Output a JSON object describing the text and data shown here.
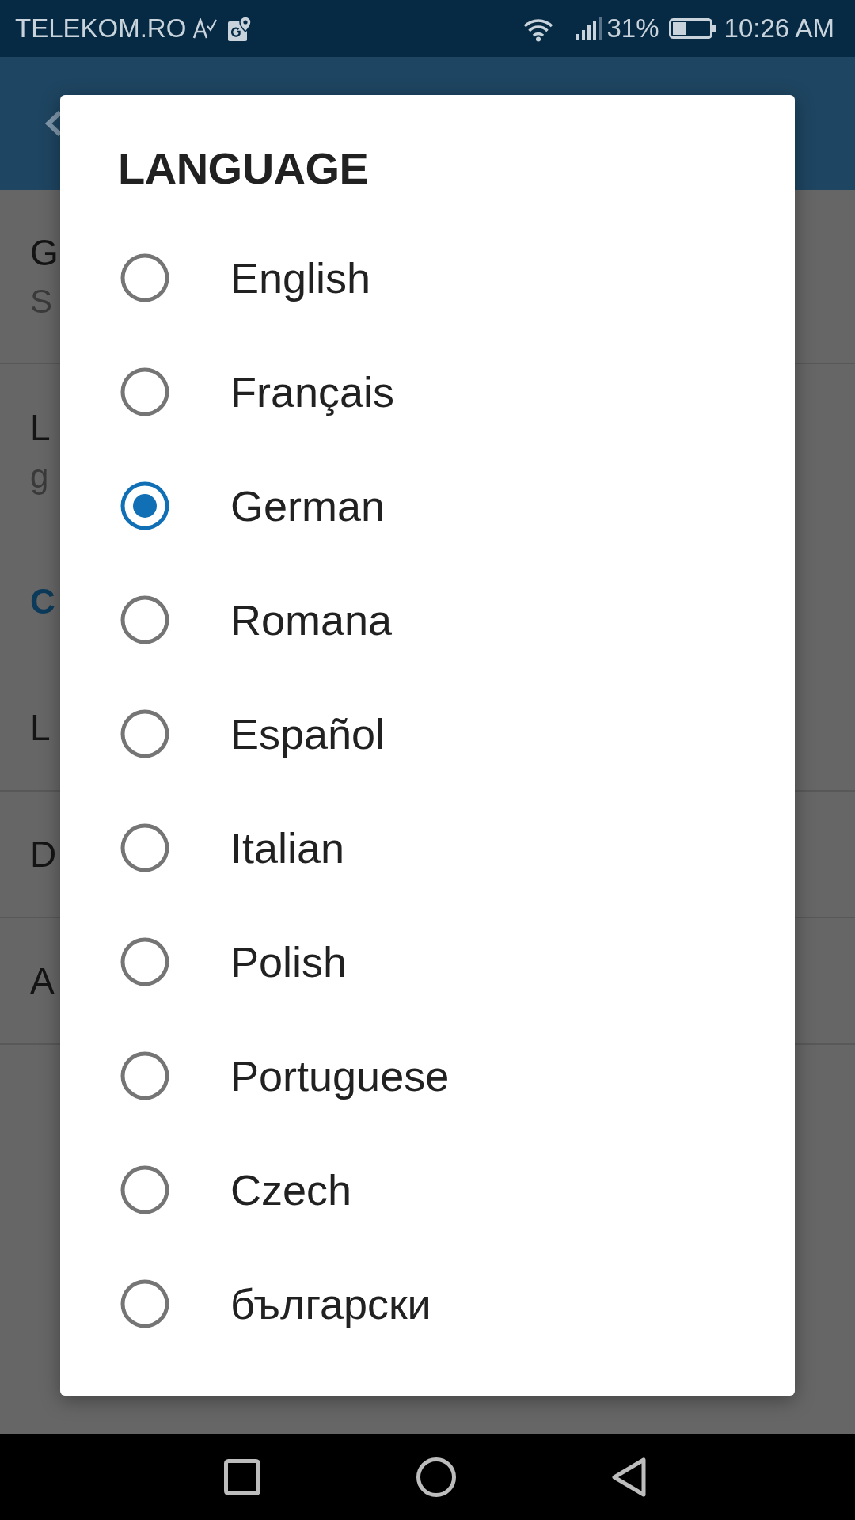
{
  "status_bar": {
    "carrier": "TELEKOM.RO",
    "battery_percent": "31%",
    "time": "10:26 AM"
  },
  "background": {
    "rows": [
      {
        "kind": "item",
        "title": "G",
        "subtitle": "S"
      },
      {
        "kind": "item",
        "title": "L",
        "subtitle": "g"
      },
      {
        "kind": "header",
        "title": "C"
      },
      {
        "kind": "item",
        "title": "L"
      },
      {
        "kind": "item",
        "title": "D"
      },
      {
        "kind": "item",
        "title": "A"
      }
    ]
  },
  "dialog": {
    "title": "LANGUAGE",
    "options": [
      {
        "label": "English",
        "selected": false
      },
      {
        "label": "Français",
        "selected": false
      },
      {
        "label": "German",
        "selected": true
      },
      {
        "label": "Romana",
        "selected": false
      },
      {
        "label": "Español",
        "selected": false
      },
      {
        "label": "Italian",
        "selected": false
      },
      {
        "label": "Polish",
        "selected": false
      },
      {
        "label": "Portuguese",
        "selected": false
      },
      {
        "label": "Czech",
        "selected": false
      },
      {
        "label": "български",
        "selected": false
      }
    ]
  }
}
